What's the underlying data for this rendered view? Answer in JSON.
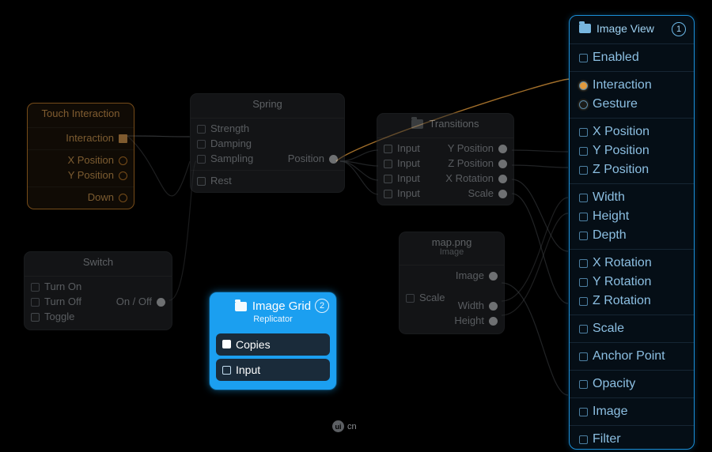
{
  "touch": {
    "title": "Touch Interaction",
    "interaction": "Interaction",
    "xpos": "X Position",
    "ypos": "Y Position",
    "down": "Down"
  },
  "switch": {
    "title": "Switch",
    "turn_on": "Turn On",
    "turn_off": "Turn Off",
    "toggle": "Toggle",
    "onoff": "On / Off"
  },
  "spring": {
    "title": "Spring",
    "strength": "Strength",
    "damping": "Damping",
    "sampling": "Sampling",
    "rest": "Rest",
    "position": "Position"
  },
  "transitions": {
    "title": "Transitions",
    "input": "Input",
    "ypos": "Y Position",
    "zpos": "Z Position",
    "xrot": "X Rotation",
    "scale": "Scale"
  },
  "map": {
    "title": "map.png",
    "subtitle": "Image",
    "scale": "Scale",
    "image": "Image",
    "width": "Width",
    "height": "Height"
  },
  "grid": {
    "title": "Image Grid",
    "subtitle": "Replicator",
    "badge": "2",
    "copies": "Copies",
    "input": "Input"
  },
  "panel": {
    "title": "Image View",
    "badge": "1",
    "enabled": "Enabled",
    "interaction": "Interaction",
    "gesture": "Gesture",
    "xpos": "X Position",
    "ypos": "Y Position",
    "zpos": "Z Position",
    "width": "Width",
    "height": "Height",
    "depth": "Depth",
    "xrot": "X Rotation",
    "yrot": "Y Rotation",
    "zrot": "Z Rotation",
    "scale": "Scale",
    "anchor": "Anchor Point",
    "opacity": "Opacity",
    "image": "Image",
    "filter": "Filter"
  },
  "watermark": {
    "logo": "ui",
    "text": "cn"
  }
}
